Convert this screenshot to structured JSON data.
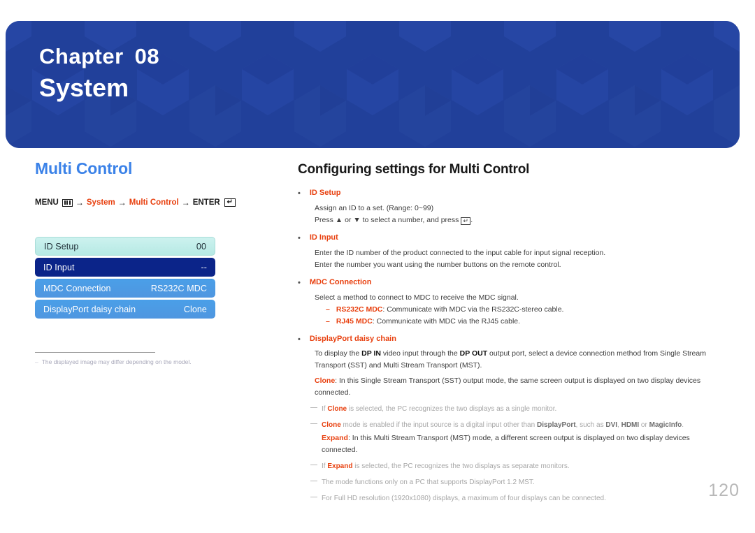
{
  "banner": {
    "chapter_label": "Chapter",
    "chapter_number": "08",
    "chapter_title": "System",
    "bg_color": "#21409a"
  },
  "left": {
    "section_title": "Multi Control",
    "section_title_color": "#3b82e8",
    "breadcrumb": {
      "menu_label": "MENU",
      "menu_icon": "menu-bars-icon",
      "arrow": "→",
      "step1": "System",
      "step2": "Multi Control",
      "enter_label": "ENTER",
      "enter_icon": "enter-key-icon",
      "accent_color": "#e8400f"
    },
    "osd_menu": {
      "rows": [
        {
          "label": "ID Setup",
          "value": "00",
          "style": "first"
        },
        {
          "label": "ID Input",
          "value": "--",
          "style": "selected"
        },
        {
          "label": "MDC Connection",
          "value": "RS232C MDC",
          "style": "normal"
        },
        {
          "label": "DisplayPort daisy chain",
          "value": "Clone",
          "style": "normal"
        }
      ]
    },
    "footnote": {
      "dash": "–",
      "text": "The displayed image may differ depending on the model."
    }
  },
  "right": {
    "title": "Configuring settings for Multi Control",
    "bullet_dot": "•",
    "sub_dash": "–",
    "tip_dash": "—",
    "sections": [
      {
        "heading": "ID Setup",
        "lines": [
          "Assign an ID to a set. (Range: 0~99)",
          "Press ▲ or ▼ to select a number, and press "
        ],
        "line2_suffix": "."
      },
      {
        "heading": "ID Input",
        "lines": [
          "Enter the ID number of the product connected to the input cable for input signal reception.",
          "Enter the number you want using the number buttons on the remote control."
        ]
      },
      {
        "heading": "MDC Connection",
        "lines": [
          "Select a method to connect to MDC to receive the MDC signal."
        ],
        "subs": [
          {
            "term": "RS232C MDC",
            "text": ": Communicate with MDC via the RS232C-stereo cable."
          },
          {
            "term": "RJ45 MDC",
            "text": ": Communicate with MDC via the RJ45 cable."
          }
        ]
      },
      {
        "heading": "DisplayPort daisy chain"
      }
    ],
    "dp_body": {
      "part1": "To display the ",
      "dp_in": "DP IN",
      "part2": " video input through the ",
      "dp_out": "DP OUT",
      "part3": " output port, select a device connection method from Single Stream Transport (SST) and Multi Stream Transport (MST).",
      "clone_term": "Clone",
      "clone_text": ": In this Single Stream Transport (SST) output mode, the same screen output is displayed on two display devices connected."
    },
    "tips": [
      {
        "pre": "If ",
        "term": "Clone",
        "post": " is selected, the PC recognizes the two displays as a single monitor."
      },
      {
        "pre": "",
        "term": "Clone",
        "post": " mode is enabled if the input source is a digital input other than ",
        "bold_a": "DisplayPort",
        "mid": ", such as ",
        "bold_b": "DVI",
        "sep1": ", ",
        "bold_c": "HDMI",
        "sep2": " or ",
        "bold_d": "MagicInfo",
        "end": ".",
        "expand_term": "Expand",
        "expand_text": ": In this Multi Stream Transport (MST) mode, a different screen output is displayed on two display devices connected."
      },
      {
        "pre": "If ",
        "term": "Expand",
        "post": " is selected, the PC recognizes the two displays as separate monitors."
      },
      {
        "pre": "The mode functions only on a PC that supports DisplayPort 1.2 MST.",
        "term": "",
        "post": ""
      },
      {
        "pre": "For Full HD resolution (1920x1080) displays, a maximum of four displays can be connected.",
        "term": "",
        "post": ""
      }
    ]
  },
  "page_number": "120"
}
